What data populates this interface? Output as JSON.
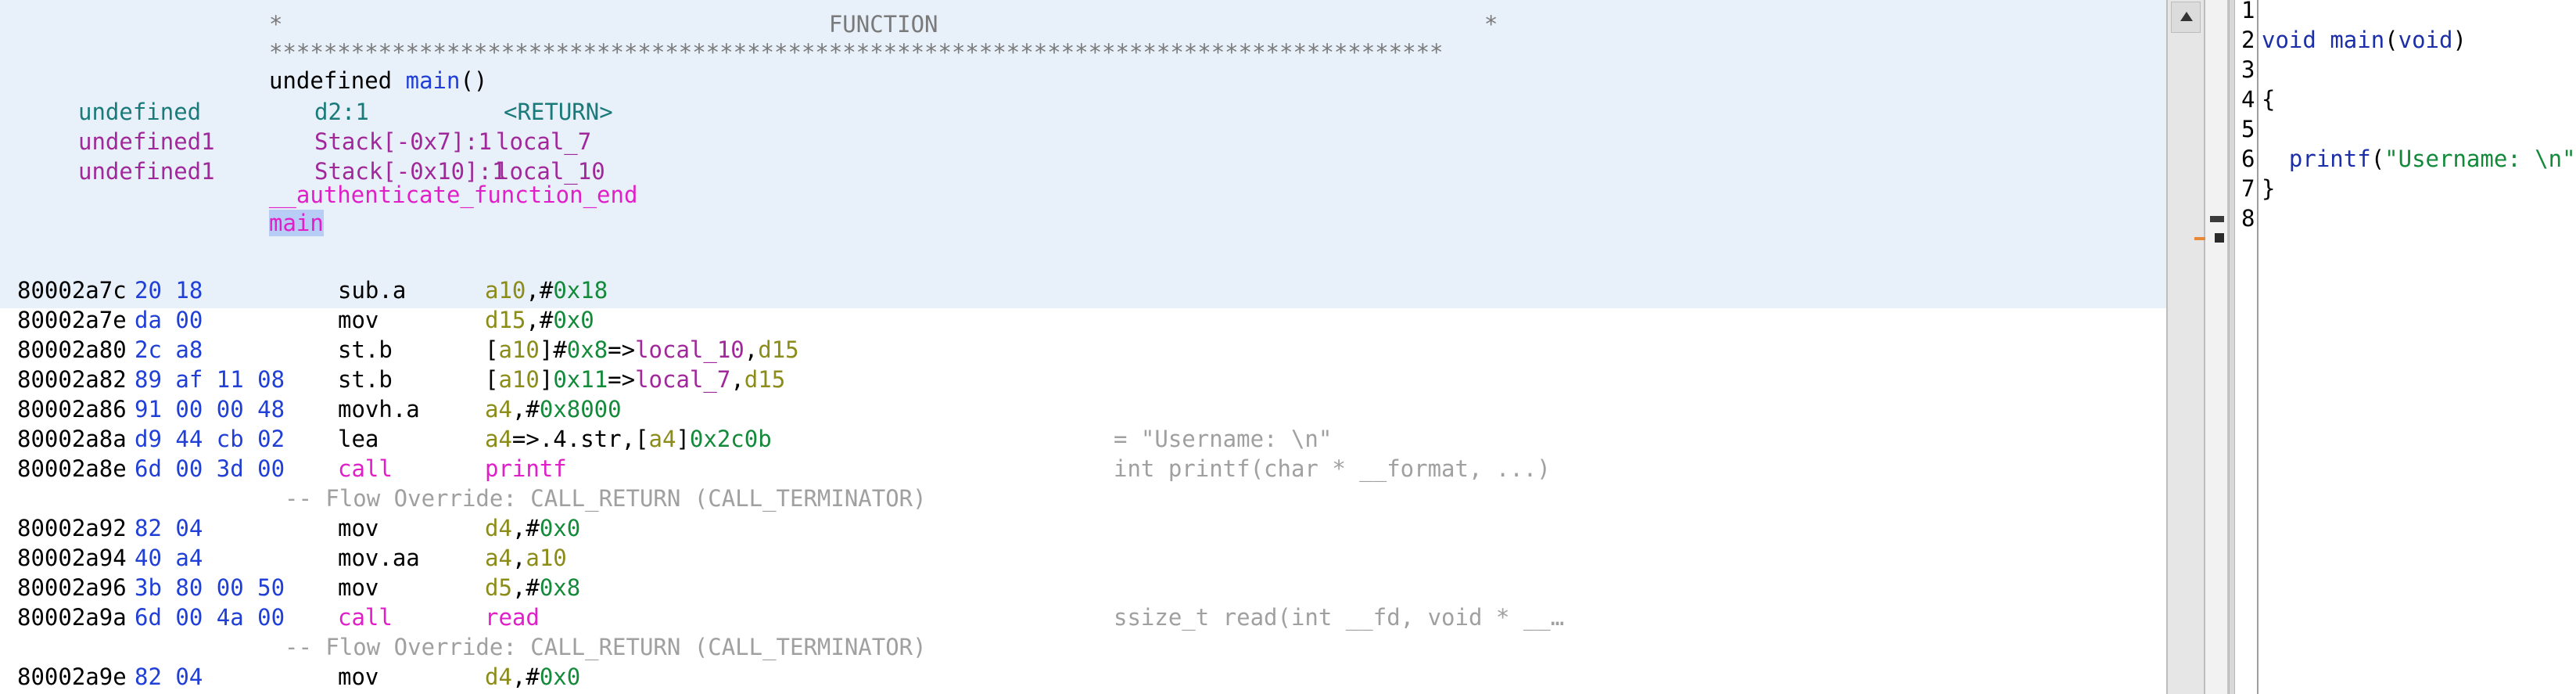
{
  "listing": {
    "header": {
      "function_banner": "*                                        FUNCTION                                        *",
      "stars": "**************************************************************************************",
      "signature_type": "undefined",
      "signature_name": "main",
      "signature_parens": "()",
      "params": [
        {
          "type": "undefined",
          "loc": "d2:1",
          "name": "<RETURN>"
        },
        {
          "type": "undefined1",
          "loc": "Stack[-0x7]:1",
          "name": "local_7"
        },
        {
          "type": "undefined1",
          "loc": "Stack[-0x10]:1",
          "name": "local_10"
        }
      ],
      "label_prev": "__authenticate_function_end",
      "label_main": "main"
    },
    "rows": [
      {
        "addr": "80002a7c",
        "bytes": "20 18",
        "mnem": "sub.a",
        "ops": [
          {
            "t": "a10",
            "c": "olive"
          },
          {
            "t": ",#",
            "c": "black"
          },
          {
            "t": "0x18",
            "c": "green"
          }
        ],
        "comment": ""
      },
      {
        "addr": "80002a7e",
        "bytes": "da 00",
        "mnem": "mov",
        "ops": [
          {
            "t": "d15",
            "c": "olive"
          },
          {
            "t": ",#",
            "c": "black"
          },
          {
            "t": "0x0",
            "c": "green"
          }
        ],
        "comment": ""
      },
      {
        "addr": "80002a80",
        "bytes": "2c a8",
        "mnem": "st.b",
        "ops": [
          {
            "t": "[",
            "c": "black"
          },
          {
            "t": "a10",
            "c": "olive"
          },
          {
            "t": "]#",
            "c": "black"
          },
          {
            "t": "0x8",
            "c": "green"
          },
          {
            "t": "=>",
            "c": "black"
          },
          {
            "t": "local_10",
            "c": "purple"
          },
          {
            "t": ",",
            "c": "black"
          },
          {
            "t": "d15",
            "c": "olive"
          }
        ],
        "comment": ""
      },
      {
        "addr": "80002a82",
        "bytes": "89 af 11 08",
        "mnem": "st.b",
        "ops": [
          {
            "t": "[",
            "c": "black"
          },
          {
            "t": "a10",
            "c": "olive"
          },
          {
            "t": "]",
            "c": "black"
          },
          {
            "t": "0x11",
            "c": "green"
          },
          {
            "t": "=>",
            "c": "black"
          },
          {
            "t": "local_7",
            "c": "purple"
          },
          {
            "t": ",",
            "c": "black"
          },
          {
            "t": "d15",
            "c": "olive"
          }
        ],
        "comment": ""
      },
      {
        "addr": "80002a86",
        "bytes": "91 00 00 48",
        "mnem": "movh.a",
        "ops": [
          {
            "t": "a4",
            "c": "olive"
          },
          {
            "t": ",#",
            "c": "black"
          },
          {
            "t": "0x8000",
            "c": "green"
          }
        ],
        "comment": ""
      },
      {
        "addr": "80002a8a",
        "bytes": "d9 44 cb 02",
        "mnem": "lea",
        "ops": [
          {
            "t": "a4",
            "c": "olive"
          },
          {
            "t": "=>.4.str,[",
            "c": "black"
          },
          {
            "t": "a4",
            "c": "olive"
          },
          {
            "t": "]",
            "c": "black"
          },
          {
            "t": "0x2c0b",
            "c": "green"
          }
        ],
        "comment": "= \"Username: \\n\""
      },
      {
        "addr": "80002a8e",
        "bytes": "6d 00 3d 00",
        "mnem": "call",
        "ops": [
          {
            "t": "printf",
            "c": "magenta"
          }
        ],
        "comment": "int printf(char * __format, ...)",
        "call": true
      },
      {
        "override": "-- Flow Override: CALL_RETURN (CALL_TERMINATOR)"
      },
      {
        "addr": "80002a92",
        "bytes": "82 04",
        "mnem": "mov",
        "ops": [
          {
            "t": "d4",
            "c": "olive"
          },
          {
            "t": ",#",
            "c": "black"
          },
          {
            "t": "0x0",
            "c": "green"
          }
        ],
        "comment": ""
      },
      {
        "addr": "80002a94",
        "bytes": "40 a4",
        "mnem": "mov.aa",
        "ops": [
          {
            "t": "a4",
            "c": "olive"
          },
          {
            "t": ",",
            "c": "black"
          },
          {
            "t": "a10",
            "c": "olive"
          }
        ],
        "comment": ""
      },
      {
        "addr": "80002a96",
        "bytes": "3b 80 00 50",
        "mnem": "mov",
        "ops": [
          {
            "t": "d5",
            "c": "olive"
          },
          {
            "t": ",#",
            "c": "black"
          },
          {
            "t": "0x8",
            "c": "green"
          }
        ],
        "comment": ""
      },
      {
        "addr": "80002a9a",
        "bytes": "6d 00 4a 00",
        "mnem": "call",
        "ops": [
          {
            "t": "read",
            "c": "magenta"
          }
        ],
        "comment": "ssize_t read(int __fd, void * __…",
        "call": true
      },
      {
        "override": "-- Flow Override: CALL_RETURN (CALL_TERMINATOR)"
      },
      {
        "addr": "80002a9e",
        "bytes": "82 04",
        "mnem": "mov",
        "ops": [
          {
            "t": "d4",
            "c": "olive"
          },
          {
            "t": ",#",
            "c": "black"
          },
          {
            "t": "0x0",
            "c": "green"
          }
        ],
        "comment": ""
      }
    ]
  },
  "decompiler": {
    "line_numbers": [
      "1",
      "2",
      "3",
      "4",
      "5",
      "6",
      "7",
      "8"
    ],
    "lines": [
      {
        "n": 2,
        "parts": [
          {
            "t": "void ",
            "c": "navy"
          },
          {
            "t": "main",
            "c": "navy"
          },
          {
            "t": "(",
            "c": "black"
          },
          {
            "t": "void",
            "c": "navy"
          },
          {
            "t": ")",
            "c": "black"
          }
        ]
      },
      {
        "n": 4,
        "parts": [
          {
            "t": "{",
            "c": "black"
          }
        ]
      },
      {
        "n": 6,
        "parts": [
          {
            "t": "  printf",
            "c": "navy"
          },
          {
            "t": "(",
            "c": "black"
          },
          {
            "t": "\"Username: \\n\"",
            "c": "green"
          },
          {
            "t": ");",
            "c": "black"
          }
        ]
      },
      {
        "n": 7,
        "parts": [
          {
            "t": "}",
            "c": "black"
          }
        ]
      }
    ]
  },
  "colors": {
    "highlight_bg": "#e8f0fa",
    "selection_bg": "#b8cdf5",
    "address": "#000000",
    "bytes": "#1f3fd6",
    "register": "#8c8c1a",
    "scalar": "#138a3a",
    "label": "#e01fc8",
    "local_var": "#a0289a",
    "comment": "#a0a0a0"
  }
}
